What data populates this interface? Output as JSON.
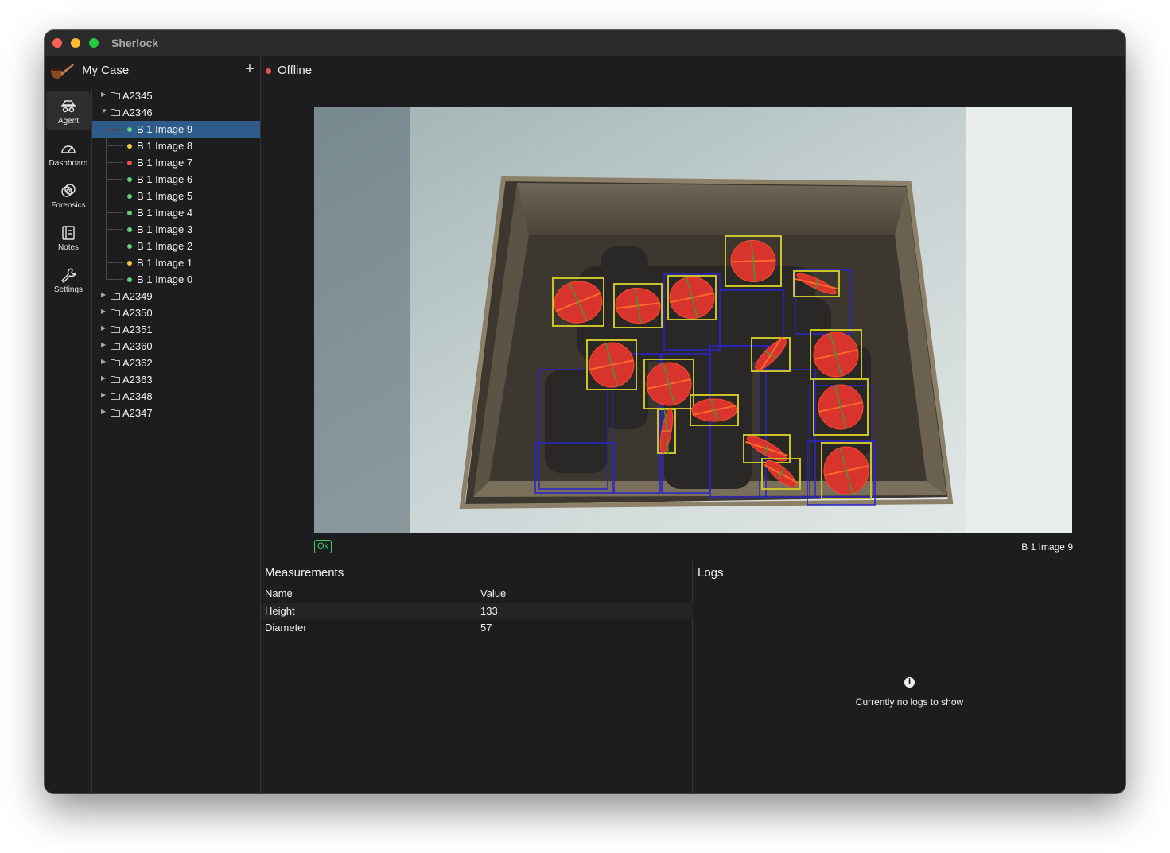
{
  "window": {
    "title": "Sherlock"
  },
  "case": {
    "title": "My Case",
    "add_label": "+"
  },
  "status": {
    "text": "Offline",
    "color": "#e5534b"
  },
  "nav": {
    "items": [
      {
        "label": "Agent",
        "icon": "agent-icon",
        "active": true
      },
      {
        "label": "Dashboard",
        "icon": "dashboard-icon",
        "active": false
      },
      {
        "label": "Forensics",
        "icon": "forensics-icon",
        "active": false
      },
      {
        "label": "Notes",
        "icon": "notes-icon",
        "active": false
      },
      {
        "label": "Settings",
        "icon": "settings-icon",
        "active": false
      }
    ]
  },
  "tree": {
    "folders_before": [
      {
        "label": "A2345",
        "expanded": false
      }
    ],
    "open_folder": {
      "label": "A2346",
      "expanded": true
    },
    "children": [
      {
        "label": "B 1 Image 9",
        "status": "green",
        "selected": true
      },
      {
        "label": "B 1 Image 8",
        "status": "yellow",
        "selected": false
      },
      {
        "label": "B 1 Image 7",
        "status": "red",
        "selected": false
      },
      {
        "label": "B 1 Image 6",
        "status": "green",
        "selected": false
      },
      {
        "label": "B 1 Image 5",
        "status": "green",
        "selected": false
      },
      {
        "label": "B 1 Image 4",
        "status": "green",
        "selected": false
      },
      {
        "label": "B 1 Image 3",
        "status": "green",
        "selected": false
      },
      {
        "label": "B 1 Image 2",
        "status": "green",
        "selected": false
      },
      {
        "label": "B 1 Image 1",
        "status": "yellow",
        "selected": false
      },
      {
        "label": "B 1 Image 0",
        "status": "green",
        "selected": false
      }
    ],
    "folders_after": [
      {
        "label": "A2349"
      },
      {
        "label": "A2350"
      },
      {
        "label": "A2351"
      },
      {
        "label": "A2360"
      },
      {
        "label": "A2362"
      },
      {
        "label": "A2363"
      },
      {
        "label": "A2348"
      },
      {
        "label": "A2347"
      }
    ],
    "status_colors": {
      "green": "#5fd37a",
      "yellow": "#f5c842",
      "red": "#e5534b"
    }
  },
  "viewer": {
    "badge": "Ok",
    "caption": "B 1 Image 9"
  },
  "measurements": {
    "title": "Measurements",
    "columns": [
      "Name",
      "Value"
    ],
    "rows": [
      {
        "name": "Height",
        "value": "133"
      },
      {
        "name": "Diameter",
        "value": "57"
      }
    ]
  },
  "logs": {
    "title": "Logs",
    "empty_text": "Currently no logs to show",
    "icon": "info-icon"
  }
}
